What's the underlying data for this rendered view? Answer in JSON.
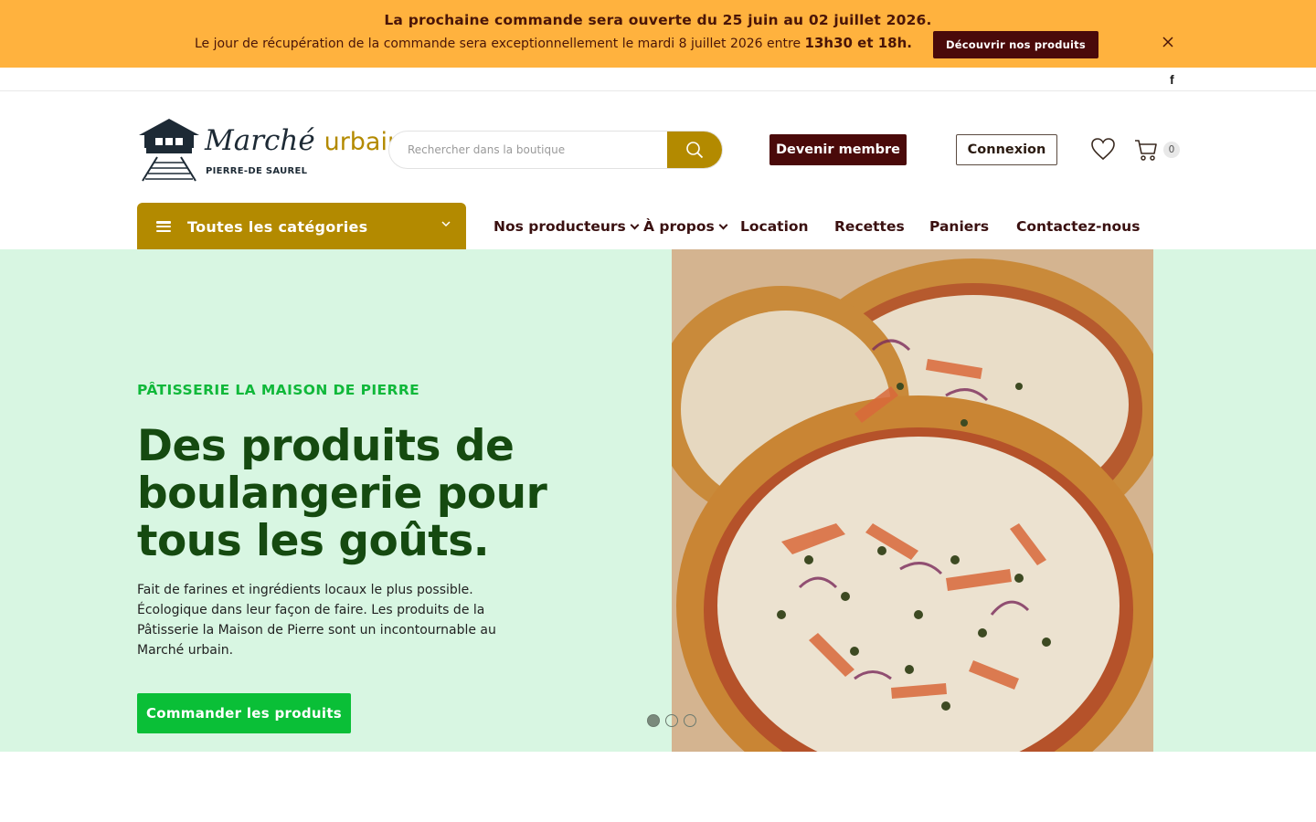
{
  "announcement": {
    "line1": "La prochaine commande sera ouverte du 25 juin au 02 juillet 2026.",
    "line2_prefix": "Le jour de récupération de la commande sera exceptionnellement le mardi 8 juillet 2026 entre ",
    "line2_bold": "13h30 et 18h.",
    "cta_label": "Découvrir nos produits",
    "close_icon": "close-icon",
    "colors": {
      "background": "#ffb23e",
      "text": "#4a1508",
      "cta": "#4a0a0a"
    }
  },
  "social": {
    "facebook_label": "f"
  },
  "header": {
    "logo_title": "Marché",
    "logo_title_accent": "urbain",
    "logo_tagline": "PIERRE-DE SAUREL",
    "search": {
      "placeholder": "Rechercher dans la boutique",
      "value": "",
      "icon": "search-icon"
    },
    "member_button": "Devenir membre",
    "login_button": "Connexion",
    "wishlist_icon": "heart-icon",
    "cart_icon": "cart-icon",
    "cart_count": "0"
  },
  "nav": {
    "categories_label": "Toutes les catégories",
    "items": [
      {
        "label": "Nos producteurs",
        "has_dropdown": true
      },
      {
        "label": "À propos",
        "has_dropdown": true
      },
      {
        "label": "Location",
        "has_dropdown": false
      },
      {
        "label": "Recettes",
        "has_dropdown": false
      },
      {
        "label": "Paniers",
        "has_dropdown": false
      },
      {
        "label": "Contactez-nous",
        "has_dropdown": false
      }
    ],
    "colors": {
      "category_button": "#b38a00"
    }
  },
  "hero": {
    "kicker": "PÂTISSERIE LA MAISON DE PIERRE",
    "title": "Des produits de boulangerie pour tous les goûts.",
    "description": "Fait de farines et ingrédients locaux le plus possible. Écologique dans leur façon de faire. Les produits de la Pâtisserie la Maison de Pierre sont un incontournable au Marché urbain.",
    "cta_label": "Commander les produits",
    "image": "pizza-photo",
    "slides": 3,
    "active_slide": 1,
    "colors": {
      "background": "#d8f6e2",
      "kicker": "#10b83a",
      "title": "#154a10",
      "cta": "#0abf37"
    }
  }
}
